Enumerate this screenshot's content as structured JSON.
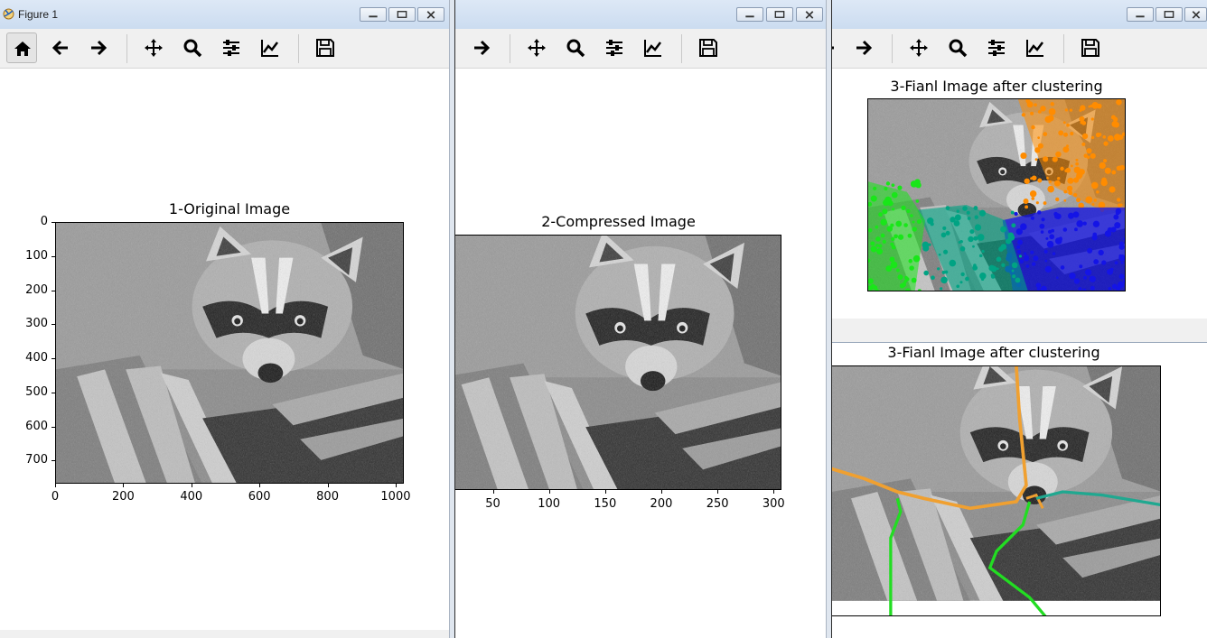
{
  "window1": {
    "title": "Figure 1",
    "plot_title": "1-Original Image",
    "y_ticks": [
      "0",
      "100",
      "200",
      "300",
      "400",
      "500",
      "600",
      "700"
    ],
    "x_ticks": [
      "0",
      "200",
      "400",
      "600",
      "800",
      "1000"
    ]
  },
  "window2": {
    "plot_title": "2-Compressed Image",
    "x_ticks": [
      "50",
      "100",
      "150",
      "200",
      "250",
      "300"
    ]
  },
  "window3": {
    "plot_title_top": "3-Fianl Image after clustering",
    "plot_title_bottom": "3-Fianl Image after clustering"
  },
  "toolbar_icons": [
    "home-icon",
    "back-arrow-icon",
    "forward-arrow-icon",
    "pan-icon",
    "zoom-icon",
    "configure-subplots-icon",
    "edit-axis-icon",
    "save-icon"
  ],
  "colors": {
    "cluster_orange": "#ff8c00",
    "cluster_blue": "#1414e6",
    "cluster_teal": "#00a383",
    "cluster_green": "#19e619",
    "boundary_orange": "#f0a030",
    "boundary_teal": "#20a890",
    "boundary_green": "#22dd22"
  }
}
